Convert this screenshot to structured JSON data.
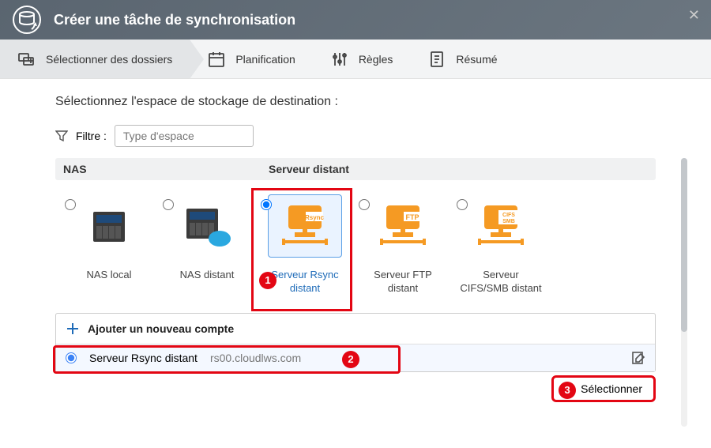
{
  "title": "Créer une tâche de synchronisation",
  "steps": {
    "folders": "Sélectionner des dossiers",
    "schedule": "Planification",
    "rules": "Règles",
    "summary": "Résumé"
  },
  "subtitle": "Sélectionnez l'espace de stockage de destination :",
  "filter": {
    "label": "Filtre :",
    "placeholder": "Type d'espace"
  },
  "groups": {
    "nas": "NAS",
    "remote": "Serveur distant"
  },
  "options": {
    "nas_local": "NAS local",
    "nas_remote": "NAS distant",
    "rsync": "Serveur Rsync distant",
    "ftp": "Serveur FTP distant",
    "cifs": "Serveur CIFS/SMB distant"
  },
  "add_account": "Ajouter un nouveau compte",
  "account": {
    "type": "Serveur Rsync distant",
    "address": "rs00.cloudlws.com"
  },
  "select_btn": "Sélectionner",
  "badges": {
    "one": "1",
    "two": "2",
    "three": "3"
  }
}
